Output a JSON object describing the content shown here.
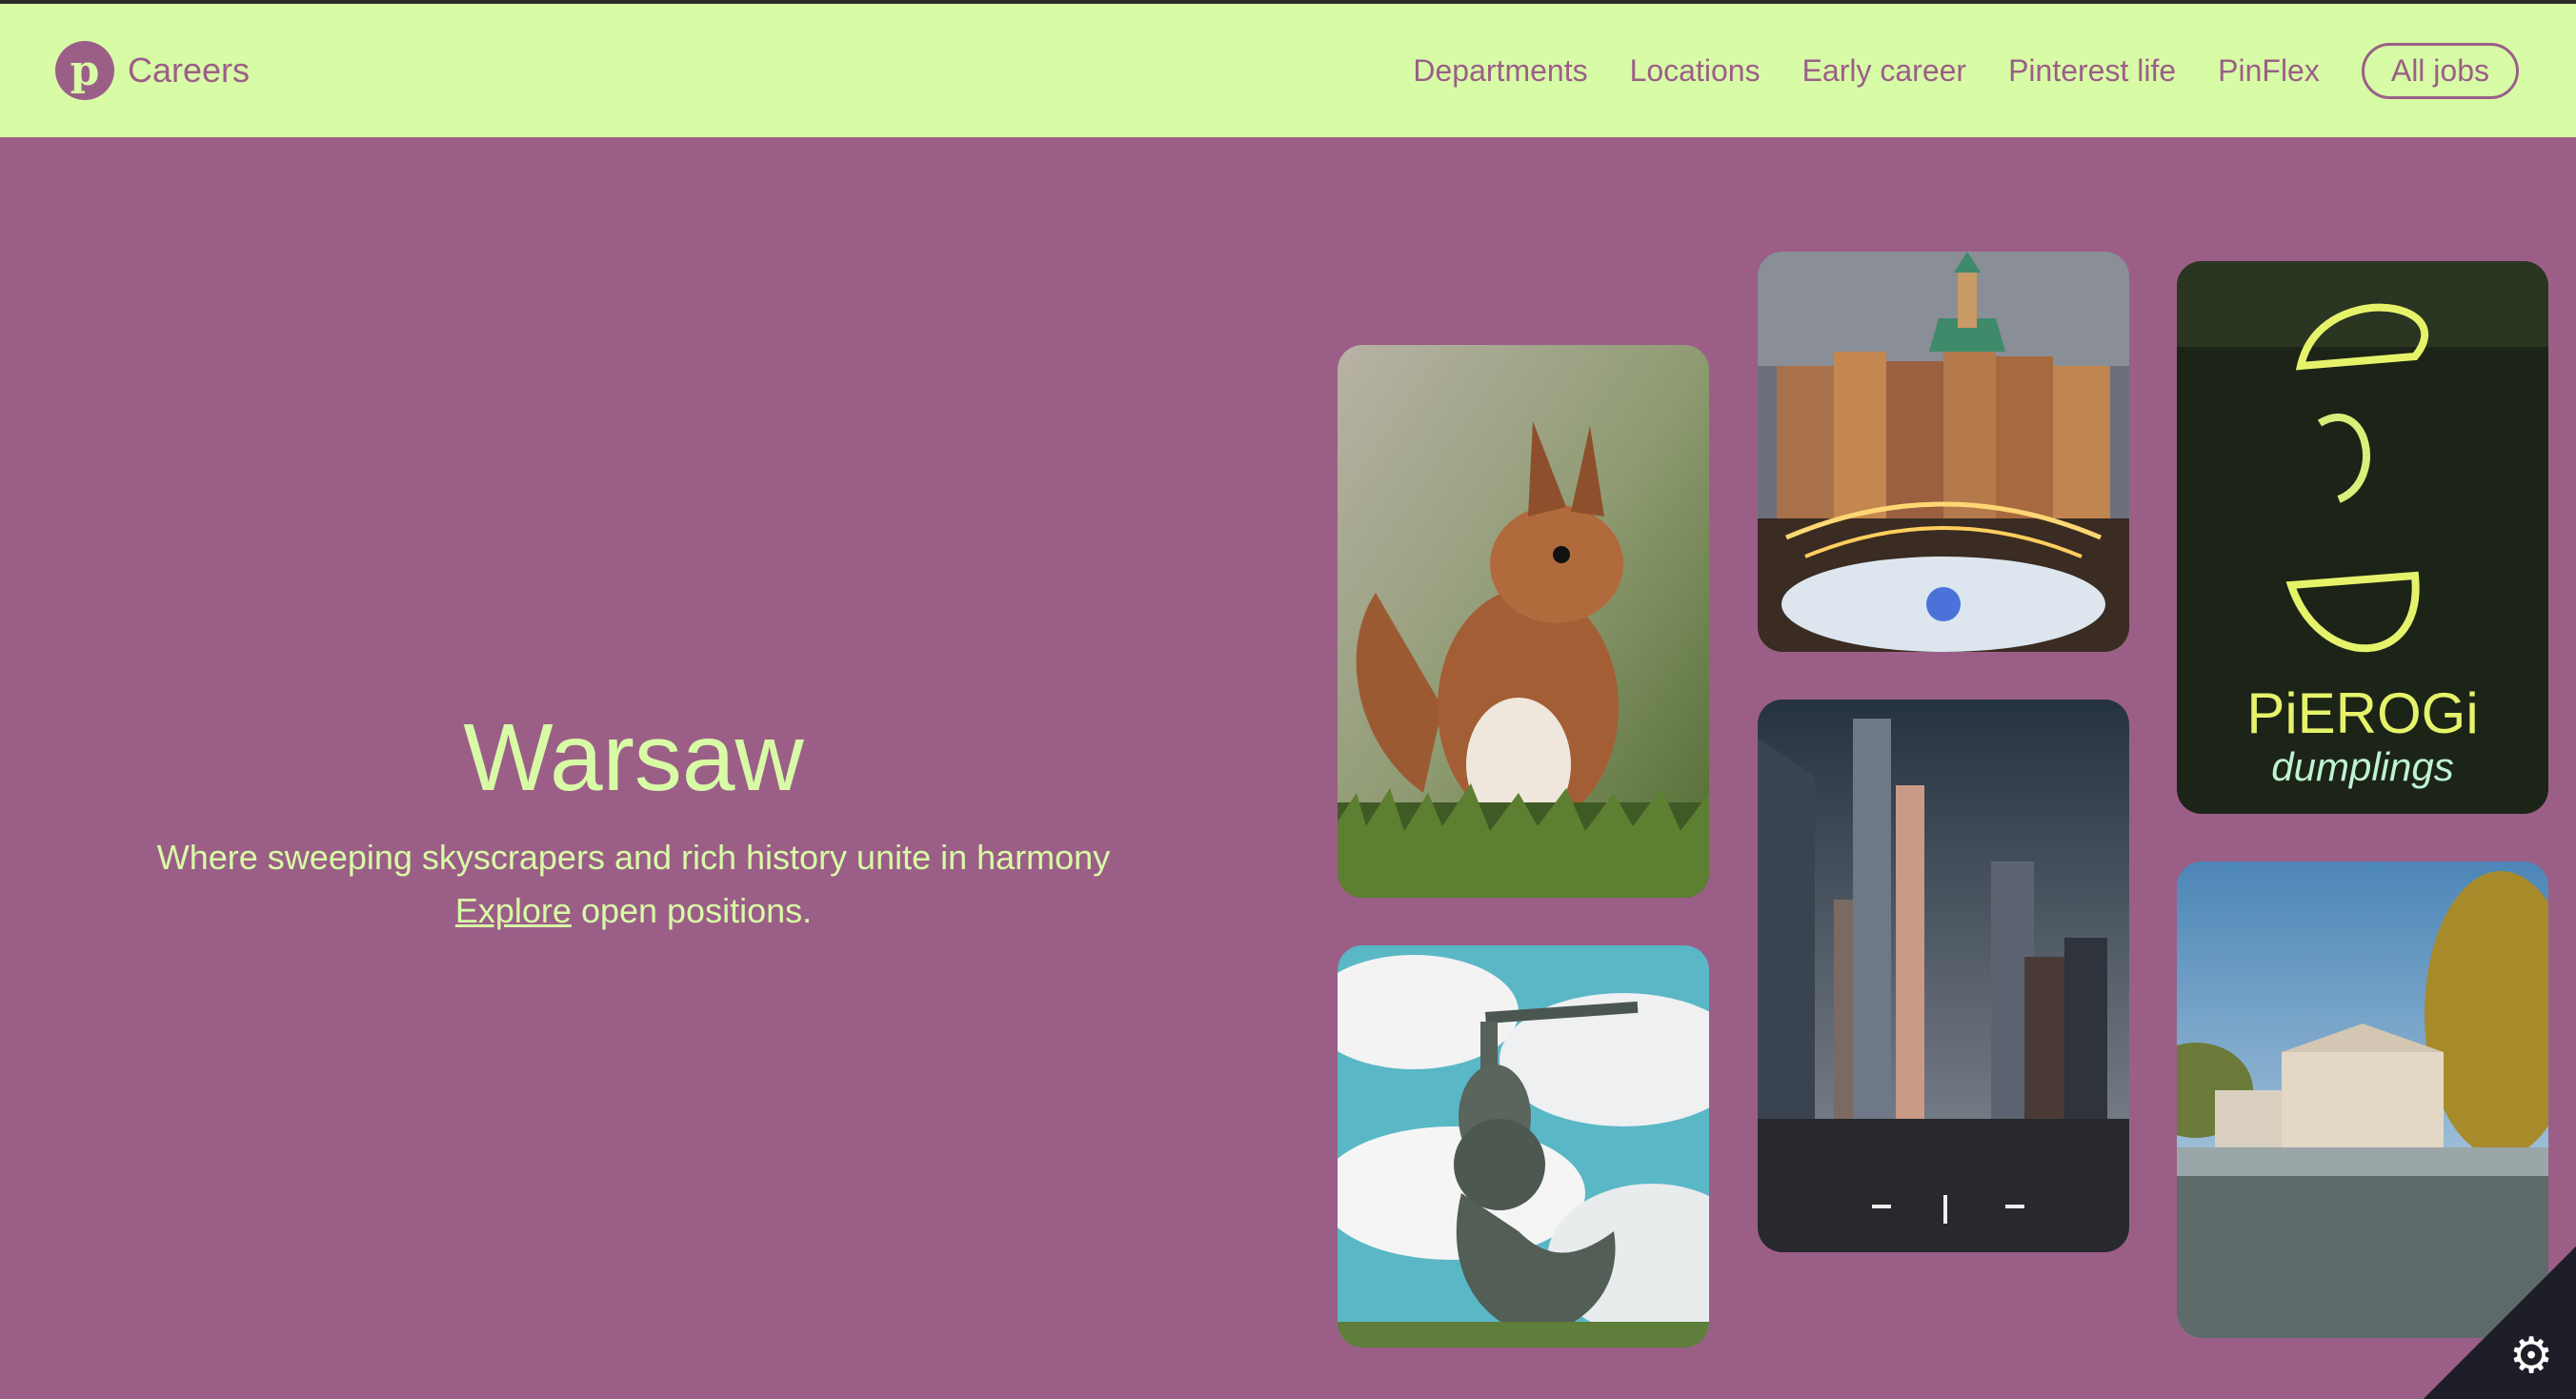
{
  "header": {
    "brand_text": "Careers",
    "nav": [
      {
        "label": "Departments"
      },
      {
        "label": "Locations"
      },
      {
        "label": "Early career"
      },
      {
        "label": "Pinterest life"
      },
      {
        "label": "PinFlex"
      }
    ],
    "all_jobs_label": "All jobs"
  },
  "hero": {
    "title": "Warsaw",
    "subtitle": "Where sweeping skyscrapers and rich history unite in harmony",
    "link_label": "Explore",
    "link_suffix": " open positions."
  },
  "photos": {
    "pierogi_sign_line1": "PiEROGi",
    "pierogi_sign_line2": "dumplings"
  },
  "colors": {
    "header_bg": "#d8fba6",
    "page_bg": "#9b5f87",
    "accent_text": "#d8fba6"
  },
  "icons": {
    "logo": "pinterest-logo-icon",
    "settings": "gear-icon"
  }
}
